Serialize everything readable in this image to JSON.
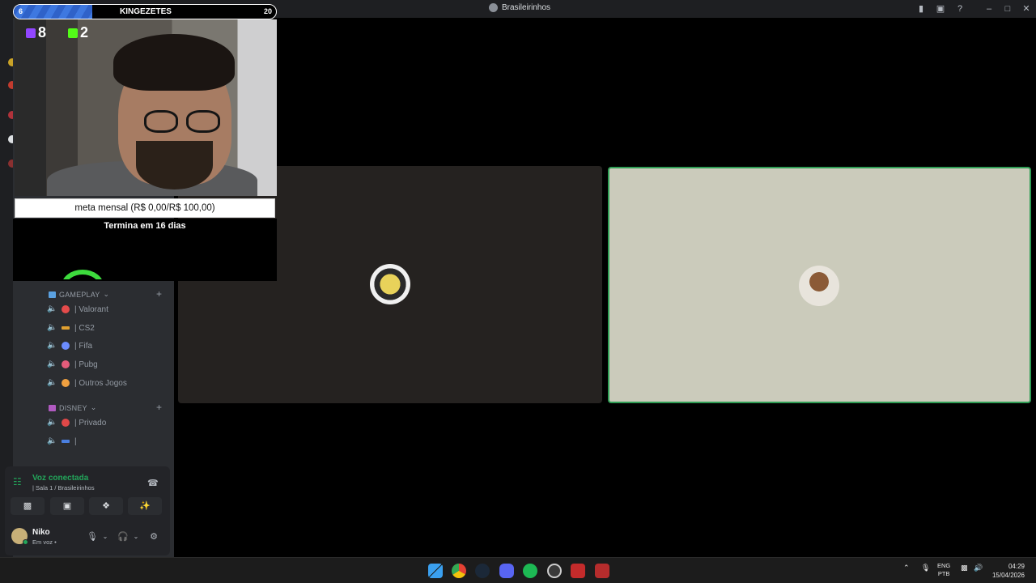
{
  "window": {
    "title": "Brasileirinhos"
  },
  "overlay": {
    "sub_left": "6",
    "sub_name": "KINGEZETES",
    "sub_right": "20",
    "sub_progress": 0.3,
    "twitch_count": "8",
    "kick_count": "2",
    "meta_label": "meta mensal (R$ 0,00/R$ 100,00)",
    "meta_sub": "Termina em 16 dias"
  },
  "sidebar": {
    "categories": [
      {
        "label": "GAMEPLAY"
      },
      {
        "label": "DISNEY"
      }
    ],
    "channels": [
      {
        "label": "| Valorant",
        "color": "#e44b4b"
      },
      {
        "label": "| CS2",
        "color": "#e0a030"
      },
      {
        "label": "| Fifa",
        "color": "#6b8cff"
      },
      {
        "label": "| Pubg",
        "color": "#e45c7b"
      },
      {
        "label": "| Outros Jogos",
        "color": "#f0a040"
      },
      {
        "label": "| Privado",
        "color": "#e04848"
      },
      {
        "label": "|",
        "color": "#4a7fe0"
      }
    ]
  },
  "voice": {
    "status": "Voz conectada",
    "location": "| Sala 1 / Brasileirinhos"
  },
  "user": {
    "name": "Niko",
    "status": "Em voz •"
  },
  "taskbar": {
    "lang_top": "ENG",
    "lang_bottom": "PTB",
    "time": "04:29",
    "date": "15/04/2026"
  },
  "colors": {
    "accent_green": "#23a55a",
    "sidebar_bg": "#2b2d31",
    "speaking_border": "#2f9e55"
  }
}
